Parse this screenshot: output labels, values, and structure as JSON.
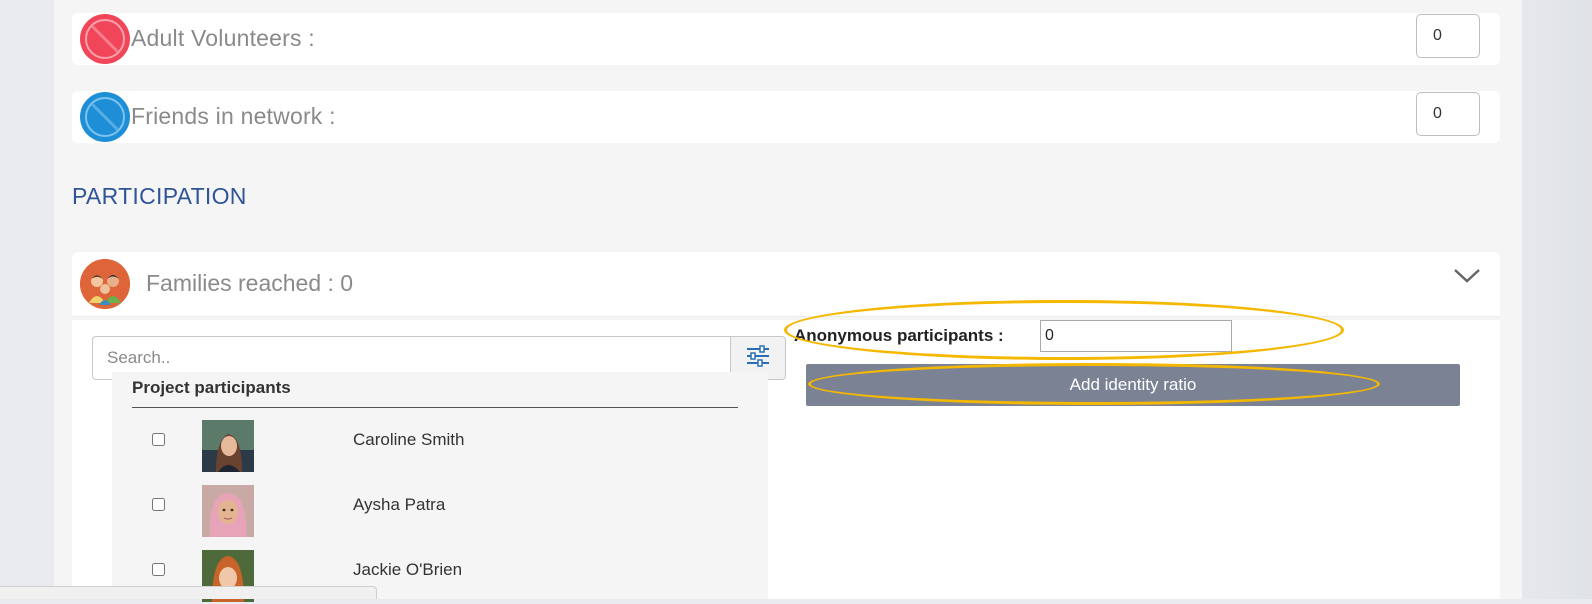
{
  "stats": [
    {
      "label": "Adult Volunteers :",
      "value": "0",
      "icon": "red-circle-icon",
      "color": "#f14659"
    },
    {
      "label": "Friends in network :",
      "value": "0",
      "icon": "blue-circle-icon",
      "color": "#1e8fd6"
    }
  ],
  "participation": {
    "section_title": "PARTICIPATION",
    "families": {
      "title": "Families reached : 0",
      "icon": "family-group-icon"
    },
    "search": {
      "placeholder": "Search.."
    },
    "participants": {
      "title": "Project participants",
      "rows": [
        {
          "name": "Caroline Smith",
          "checked": false
        },
        {
          "name": "Aysha Patra",
          "checked": false
        },
        {
          "name": "Jackie O'Brien",
          "checked": false
        }
      ]
    },
    "anonymous": {
      "label": "Anonymous participants :",
      "value": "0"
    },
    "add_ratio_label": "Add identity ratio"
  },
  "colors": {
    "accent_title": "#2f5597",
    "button": "#7a8294",
    "highlight": "#f5b800"
  }
}
